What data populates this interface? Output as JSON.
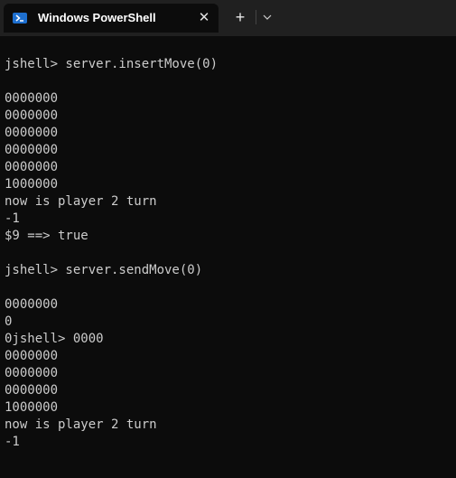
{
  "tab": {
    "title": "Windows PowerShell",
    "close_glyph": "✕",
    "icon": "powershell-icon"
  },
  "toolbar": {
    "new_tab_glyph": "+",
    "dropdown_glyph": "⌄"
  },
  "terminal": {
    "lines": [
      "",
      "jshell> server.insertMove(0)",
      "",
      "0000000",
      "0000000",
      "0000000",
      "0000000",
      "0000000",
      "1000000",
      "now is player 2 turn",
      "-1",
      "$9 ==> true",
      "",
      "jshell> server.sendMove(0)",
      "",
      "0000000",
      "0",
      "0jshell> 0000",
      "0000000",
      "0000000",
      "0000000",
      "1000000",
      "now is player 2 turn",
      "-1"
    ]
  },
  "colors": {
    "background": "#0c0c0c",
    "titlebar": "#202020",
    "text": "#cccccc",
    "accent": "#1e6fcf"
  }
}
